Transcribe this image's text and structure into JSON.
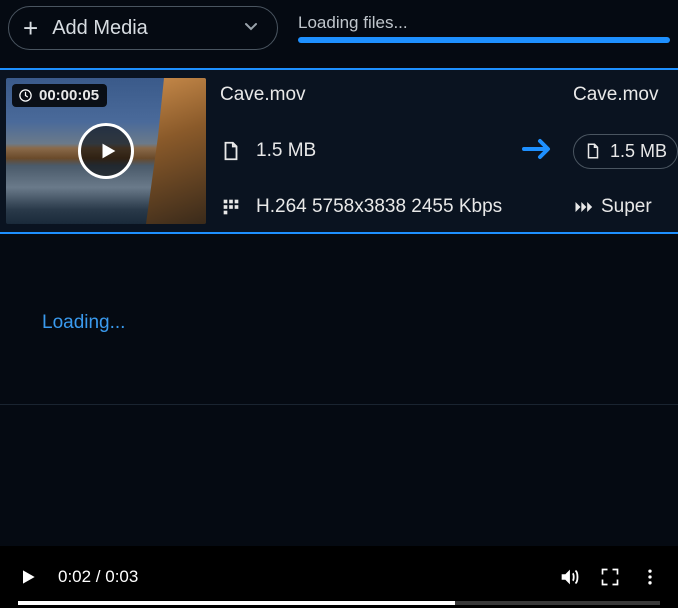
{
  "toolbar": {
    "add_media_label": "Add Media",
    "loading_label": "Loading files...",
    "progress_percent": 100
  },
  "media": {
    "duration": "00:00:05",
    "filename": "Cave.mov",
    "size": "1.5 MB",
    "codec_line": "H.264 5758x3838 2455 Kbps",
    "dup_filename": "Cave.mov",
    "dup_size": "1.5 MB",
    "dup_extra": "Super"
  },
  "panel": {
    "loading_label": "Loading..."
  },
  "player": {
    "time_label": "0:02 / 0:03"
  }
}
